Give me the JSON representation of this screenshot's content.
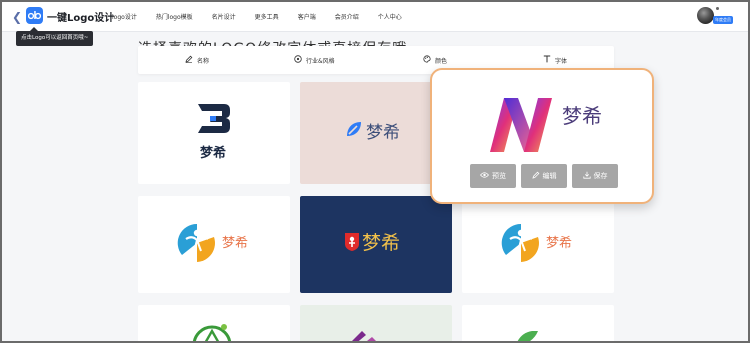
{
  "header": {
    "brand": "一键Logo设计",
    "nav": [
      "logo设计",
      "热门logo模板",
      "名片设计",
      "更多工具",
      "客户端",
      "会员介绍",
      "个人中心"
    ],
    "vip_tag": "年度会员"
  },
  "tooltip": "点击Logo可以返回首页哦~",
  "heading": "选择喜欢的LOGO修改字体或直接保存哦",
  "filters": [
    {
      "label": "名称",
      "icon": "pen-icon"
    },
    {
      "label": "行业&风格",
      "icon": "compass-icon"
    },
    {
      "label": "颜色",
      "icon": "palette-icon"
    },
    {
      "label": "字体",
      "icon": "text-icon"
    }
  ],
  "brand_name": "梦希",
  "popup": {
    "preview_label": "预览",
    "edit_label": "编辑",
    "save_label": "保存"
  },
  "colors": {
    "accent": "#2f7cf6",
    "popup_border": "#f0b27a",
    "pink_card": "#ecdcd8",
    "navy_card": "#1d3461",
    "orange_text": "#e8754a",
    "blue_text": "#2f7cf6"
  }
}
